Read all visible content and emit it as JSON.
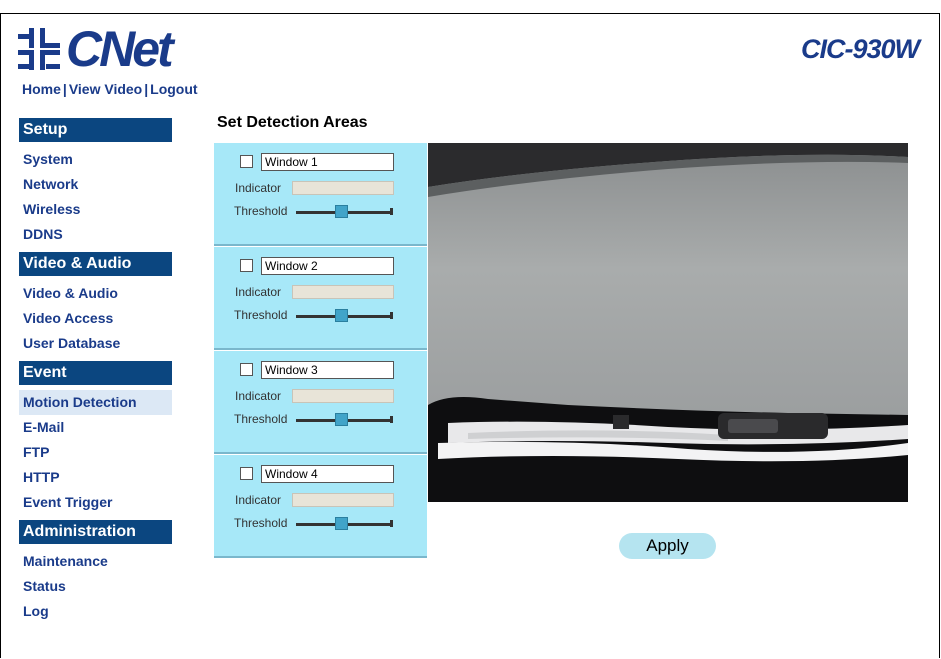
{
  "header": {
    "brand": "CNet",
    "model": "CIC-930W",
    "links": [
      "Home",
      "View Video",
      "Logout"
    ],
    "brand_color": "#1a3b8a"
  },
  "sidebar": {
    "sections": [
      {
        "title": "Setup",
        "items": [
          "System",
          "Network",
          "Wireless",
          "DDNS"
        ]
      },
      {
        "title": "Video & Audio",
        "items": [
          "Video & Audio",
          "Video Access",
          "User Database"
        ]
      },
      {
        "title": "Event",
        "items": [
          "Motion Detection",
          "E-Mail",
          "FTP",
          "HTTP",
          "Event Trigger"
        ]
      },
      {
        "title": "Administration",
        "items": [
          "Maintenance",
          "Status",
          "Log"
        ]
      }
    ],
    "active_item": "Motion Detection",
    "header_color": "#0b4680"
  },
  "main": {
    "title": "Set Detection Areas",
    "windows": [
      {
        "name": "Window 1",
        "checked": false,
        "indicator_label": "Indicator",
        "threshold_label": "Threshold",
        "threshold_fraction": 0.47
      },
      {
        "name": "Window 2",
        "checked": false,
        "indicator_label": "Indicator",
        "threshold_label": "Threshold",
        "threshold_fraction": 0.47
      },
      {
        "name": "Window 3",
        "checked": false,
        "indicator_label": "Indicator",
        "threshold_label": "Threshold",
        "threshold_fraction": 0.47
      },
      {
        "name": "Window 4",
        "checked": false,
        "indicator_label": "Indicator",
        "threshold_label": "Threshold",
        "threshold_fraction": 0.47
      }
    ],
    "apply_label": "Apply",
    "panel_color": "#a7e8f8"
  }
}
